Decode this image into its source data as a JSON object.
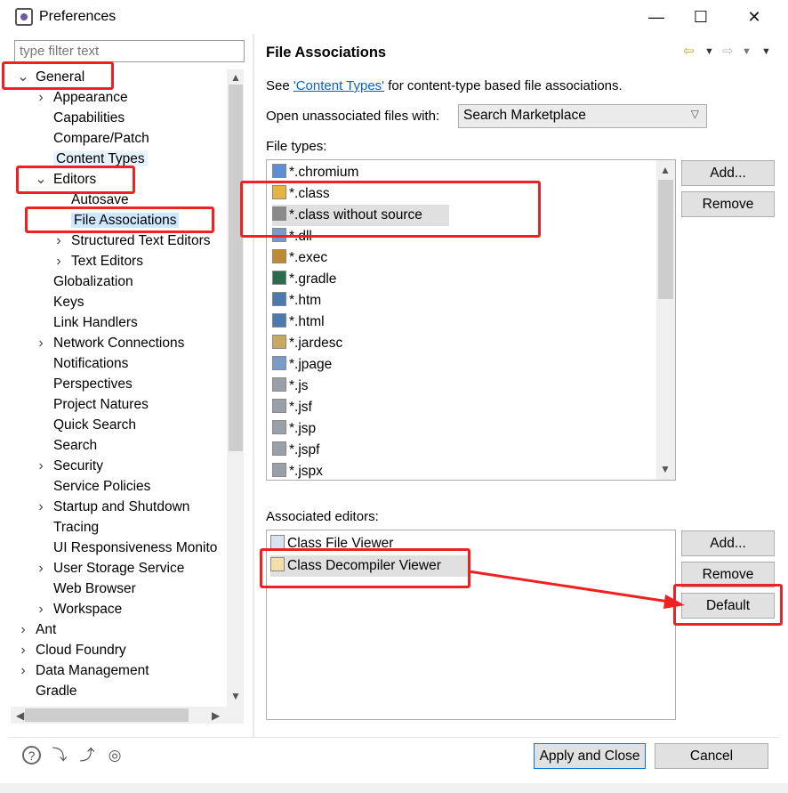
{
  "window": {
    "title": "Preferences",
    "minimize": "—",
    "maximize": "☐",
    "close": "✕"
  },
  "filter": {
    "placeholder": "type filter text"
  },
  "tree": [
    {
      "label": "General",
      "twisty": "v",
      "depth": 0
    },
    {
      "label": "Appearance",
      "twisty": ">",
      "depth": 1
    },
    {
      "label": "Capabilities",
      "twisty": "",
      "depth": 1
    },
    {
      "label": "Compare/Patch",
      "twisty": "",
      "depth": 1
    },
    {
      "label": "Content Types",
      "twisty": "",
      "depth": 1
    },
    {
      "label": "Editors",
      "twisty": "v",
      "depth": 1
    },
    {
      "label": "Autosave",
      "twisty": "",
      "depth": 2
    },
    {
      "label": "File Associations",
      "twisty": "",
      "depth": 2
    },
    {
      "label": "Structured Text Editors",
      "twisty": ">",
      "depth": 2
    },
    {
      "label": "Text Editors",
      "twisty": ">",
      "depth": 2
    },
    {
      "label": "Globalization",
      "twisty": "",
      "depth": 1
    },
    {
      "label": "Keys",
      "twisty": "",
      "depth": 1
    },
    {
      "label": "Link Handlers",
      "twisty": "",
      "depth": 1
    },
    {
      "label": "Network Connections",
      "twisty": ">",
      "depth": 1
    },
    {
      "label": "Notifications",
      "twisty": "",
      "depth": 1
    },
    {
      "label": "Perspectives",
      "twisty": "",
      "depth": 1
    },
    {
      "label": "Project Natures",
      "twisty": "",
      "depth": 1
    },
    {
      "label": "Quick Search",
      "twisty": "",
      "depth": 1
    },
    {
      "label": "Search",
      "twisty": "",
      "depth": 1
    },
    {
      "label": "Security",
      "twisty": ">",
      "depth": 1
    },
    {
      "label": "Service Policies",
      "twisty": "",
      "depth": 1
    },
    {
      "label": "Startup and Shutdown",
      "twisty": ">",
      "depth": 1
    },
    {
      "label": "Tracing",
      "twisty": "",
      "depth": 1
    },
    {
      "label": "UI Responsiveness Monito",
      "twisty": "",
      "depth": 1
    },
    {
      "label": "User Storage Service",
      "twisty": ">",
      "depth": 1
    },
    {
      "label": "Web Browser",
      "twisty": "",
      "depth": 1
    },
    {
      "label": "Workspace",
      "twisty": ">",
      "depth": 1
    },
    {
      "label": "Ant",
      "twisty": ">",
      "depth": 0
    },
    {
      "label": "Cloud Foundry",
      "twisty": ">",
      "depth": 0
    },
    {
      "label": "Data Management",
      "twisty": ">",
      "depth": 0
    },
    {
      "label": "Gradle",
      "twisty": "",
      "depth": 0
    }
  ],
  "page": {
    "title": "File Associations",
    "intro_prefix": "See ",
    "intro_link": "'Content Types'",
    "intro_suffix": " for content-type based file associations.",
    "open_label": "Open unassociated files with:",
    "open_value": "Search Marketplace",
    "file_types_label": "File types:",
    "file_types": [
      "*.chromium",
      "*.class",
      "*.class without source",
      "*.dll",
      "*.exec",
      "*.gradle",
      "*.htm",
      "*.html",
      "*.jardesc",
      "*.jpage",
      "*.js",
      "*.jsf",
      "*.jsp",
      "*.jspf",
      "*.jspx"
    ],
    "assoc_label": "Associated editors:",
    "editors": [
      "Class File Viewer",
      "Class Decompiler Viewer"
    ],
    "btn_add": "Add...",
    "btn_remove": "Remove",
    "btn_default": "Default"
  },
  "footer": {
    "apply_close": "Apply and Close",
    "cancel": "Cancel"
  },
  "colors": {
    "annotation": "#ee2222",
    "selection": "#cde8ff",
    "link": "#0066cc"
  }
}
